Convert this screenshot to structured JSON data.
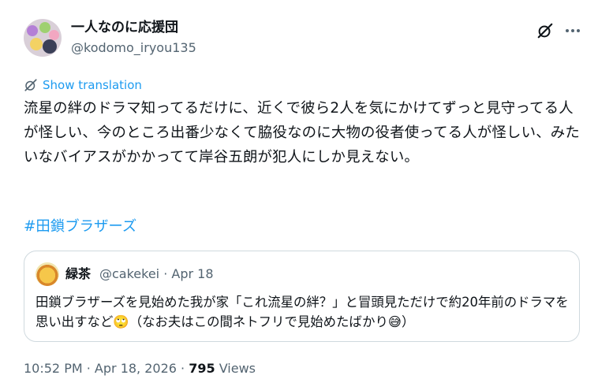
{
  "tweet": {
    "display_name": "一人なのに応援団",
    "handle": "@kodomo_iryou135",
    "show_translation": "Show translation",
    "text": "流星の絆のドラマ知ってるだけに、近くで彼ら2人を気にかけてずっと見守ってる人が怪しい、今のところ出番少なくて脇役なのに大物の役者使ってる人が怪しい、みたいなバイアスがかかってて岸谷五朗が犯人にしか見えない。",
    "hashtag": "#田鎖ブラザーズ",
    "time": "10:52 PM",
    "date": "Apr 18, 2026",
    "views_count": "795",
    "views_label": "Views"
  },
  "quote": {
    "name": "緑茶",
    "handle": "@cakekei",
    "date": "Apr 18",
    "text": "田鎖ブラザーズを見始めた我が家「これ流星の絆？」と冒頭見ただけで約20年前のドラマを思い出すなど🙄（なお夫はこの間ネトフリで見始めたばかり😅）"
  },
  "icons": {
    "grok": "grok-icon",
    "more": "more-dots-icon",
    "translate": "translate-icon"
  },
  "colors": {
    "accent": "#1d9bf0",
    "secondary_text": "#536471",
    "border": "#cfd9de"
  }
}
